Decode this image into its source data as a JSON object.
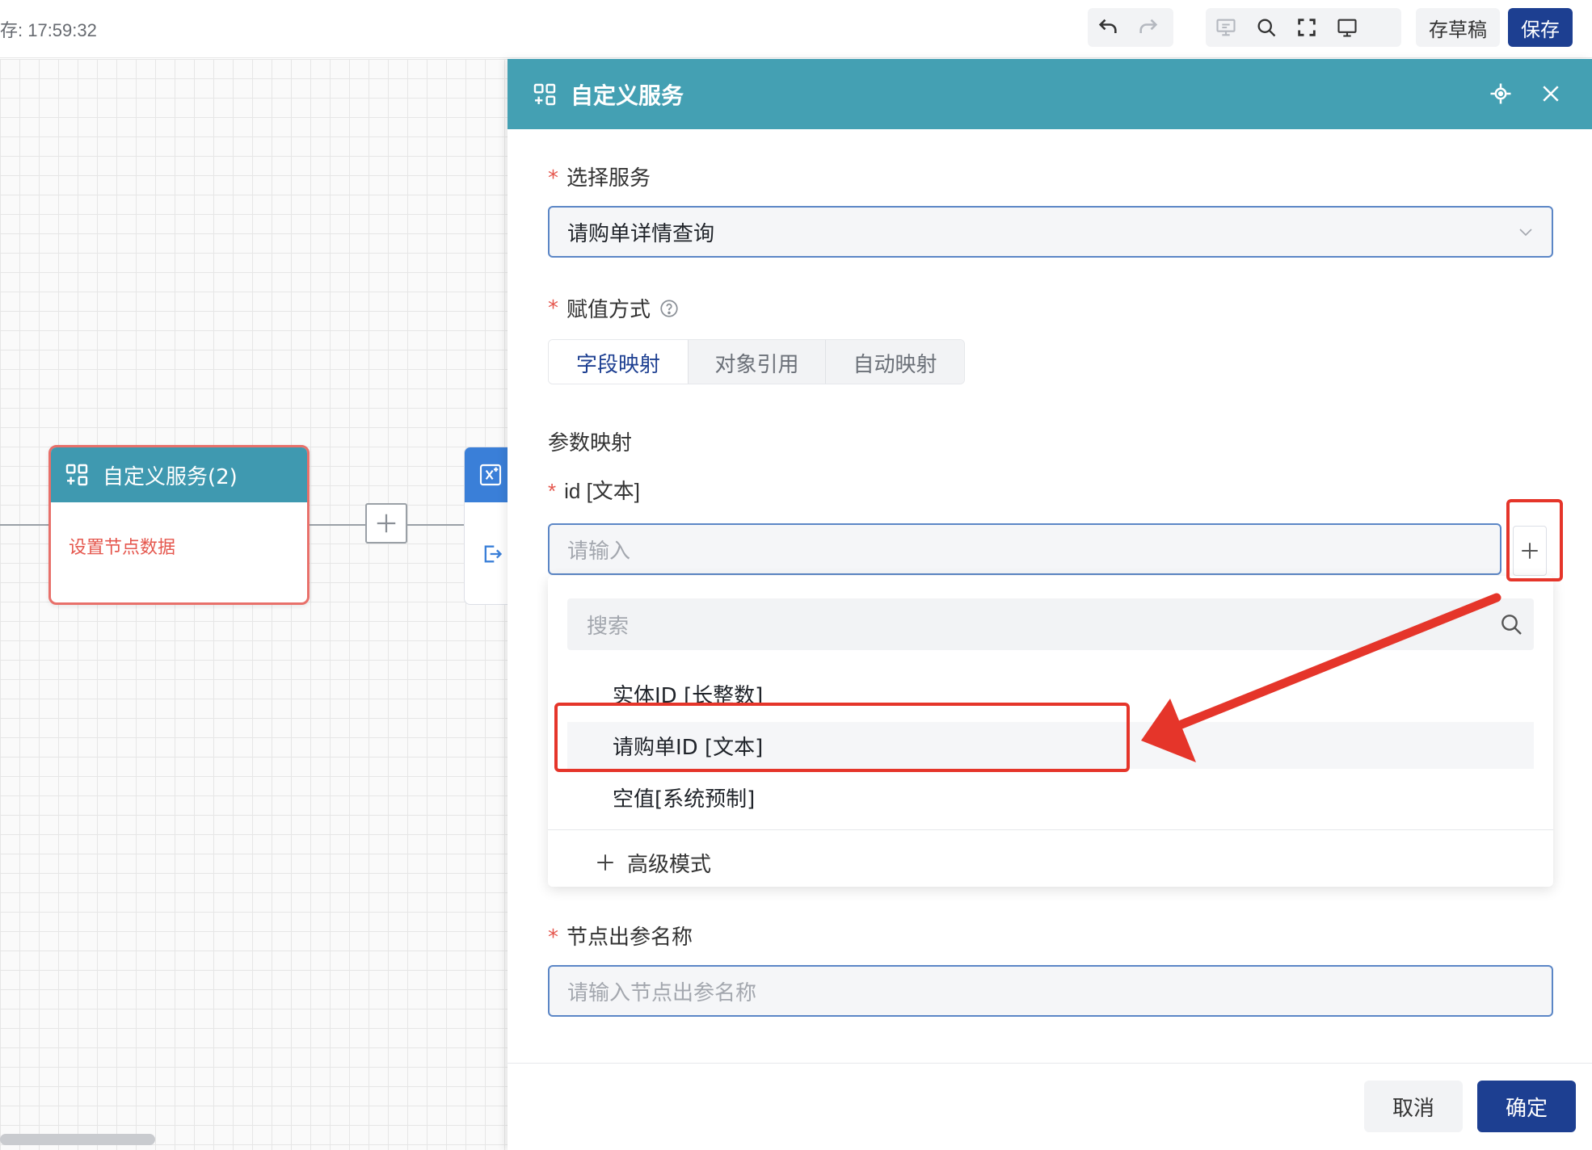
{
  "toolbar": {
    "save_time": "存: 17:59:32",
    "icons": [
      "undo-icon",
      "redo-icon",
      "preview-icon",
      "search-icon",
      "fullscreen-icon",
      "monitor-icon"
    ],
    "draft_label": "存草稿",
    "save_label": "保存"
  },
  "canvas": {
    "node": {
      "title": "自定义服务(2)",
      "body": "设置节点数据"
    }
  },
  "drawer": {
    "title": "自定义服务",
    "service": {
      "label": "选择服务",
      "value": "请购单详情查询"
    },
    "assign": {
      "label": "赋值方式",
      "options": [
        "字段映射",
        "对象引用",
        "自动映射"
      ],
      "active": "字段映射"
    },
    "param_section": "参数映射",
    "param": {
      "label": "id [文本]",
      "placeholder": "请输入"
    },
    "dropdown": {
      "search_placeholder": "搜索",
      "items": [
        "实体ID [长整数]",
        "请购单ID [文本]",
        "空值[系统预制]"
      ],
      "highlighted": "请购单ID [文本]",
      "advanced": "高级模式"
    },
    "output": {
      "label": "节点出参名称",
      "placeholder": "请输入节点出参名称"
    },
    "cancel": "取消",
    "confirm": "确定"
  },
  "colors": {
    "header_teal": "#44a0b3",
    "primary_blue": "#1d3f91",
    "required_red": "#e5574e",
    "annotation_red": "#e5352a"
  }
}
